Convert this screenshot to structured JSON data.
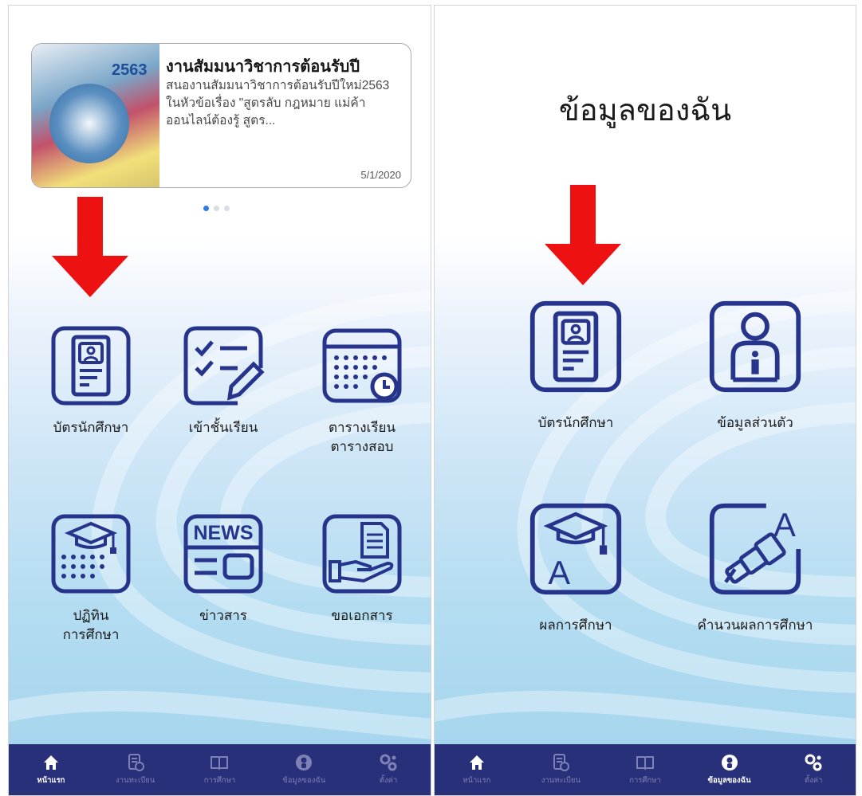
{
  "left_screen": {
    "banner": {
      "thumb_year": "2563",
      "title": "งานสัมมนาวิชาการต้อนรับปี",
      "body": "สนองานสัมมนาวิชาการต้อนรับปีใหม่2563 ในหัวข้อเรื่อง \"สูตรลับ กฎหมาย แม่ค้าออนไลน์ต้องรู้ สูตร...",
      "date": "5/1/2020"
    },
    "menu": {
      "student_card": "บัตรนักศึกษา",
      "check_in": "เข้าชั้นเรียน",
      "schedule_line1": "ตารางเรียน",
      "schedule_line2": "ตารางสอบ",
      "calendar_line1": "ปฏิทิน",
      "calendar_line2": "การศึกษา",
      "news": "ข่าวสาร",
      "request_docs": "ขอเอกสาร"
    },
    "nav": [
      {
        "label": "หน้าแรก",
        "icon": "home-icon",
        "active": true
      },
      {
        "label": "งานทะเบียน",
        "icon": "registration-icon",
        "active": false
      },
      {
        "label": "การศึกษา",
        "icon": "book-icon",
        "active": false
      },
      {
        "label": "ข้อมูลของฉัน",
        "icon": "profile-icon",
        "active": false
      },
      {
        "label": "ตั้งค่า",
        "icon": "settings-icon",
        "active": false
      }
    ]
  },
  "right_screen": {
    "heading": "ข้อมูลของฉัน",
    "menu": {
      "student_card": "บัตรนักศึกษา",
      "personal_info": "ข้อมูลส่วนตัว",
      "grades": "ผลการศึกษา",
      "gpa_calc": "คำนวนผลการศึกษา"
    },
    "nav": [
      {
        "label": "หน้าแรก",
        "icon": "home-icon",
        "active": false
      },
      {
        "label": "งานทะเบียน",
        "icon": "registration-icon",
        "active": false
      },
      {
        "label": "การศึกษา",
        "icon": "book-icon",
        "active": false
      },
      {
        "label": "ข้อมูลของฉัน",
        "icon": "profile-icon",
        "active": true
      },
      {
        "label": "ตั้งค่า",
        "icon": "settings-icon",
        "active": false
      }
    ]
  },
  "colors": {
    "icon_navy": "#27348b",
    "nav_bar": "#29307a",
    "arrow_red": "#ee1111",
    "dot_active": "#2f7de1"
  }
}
